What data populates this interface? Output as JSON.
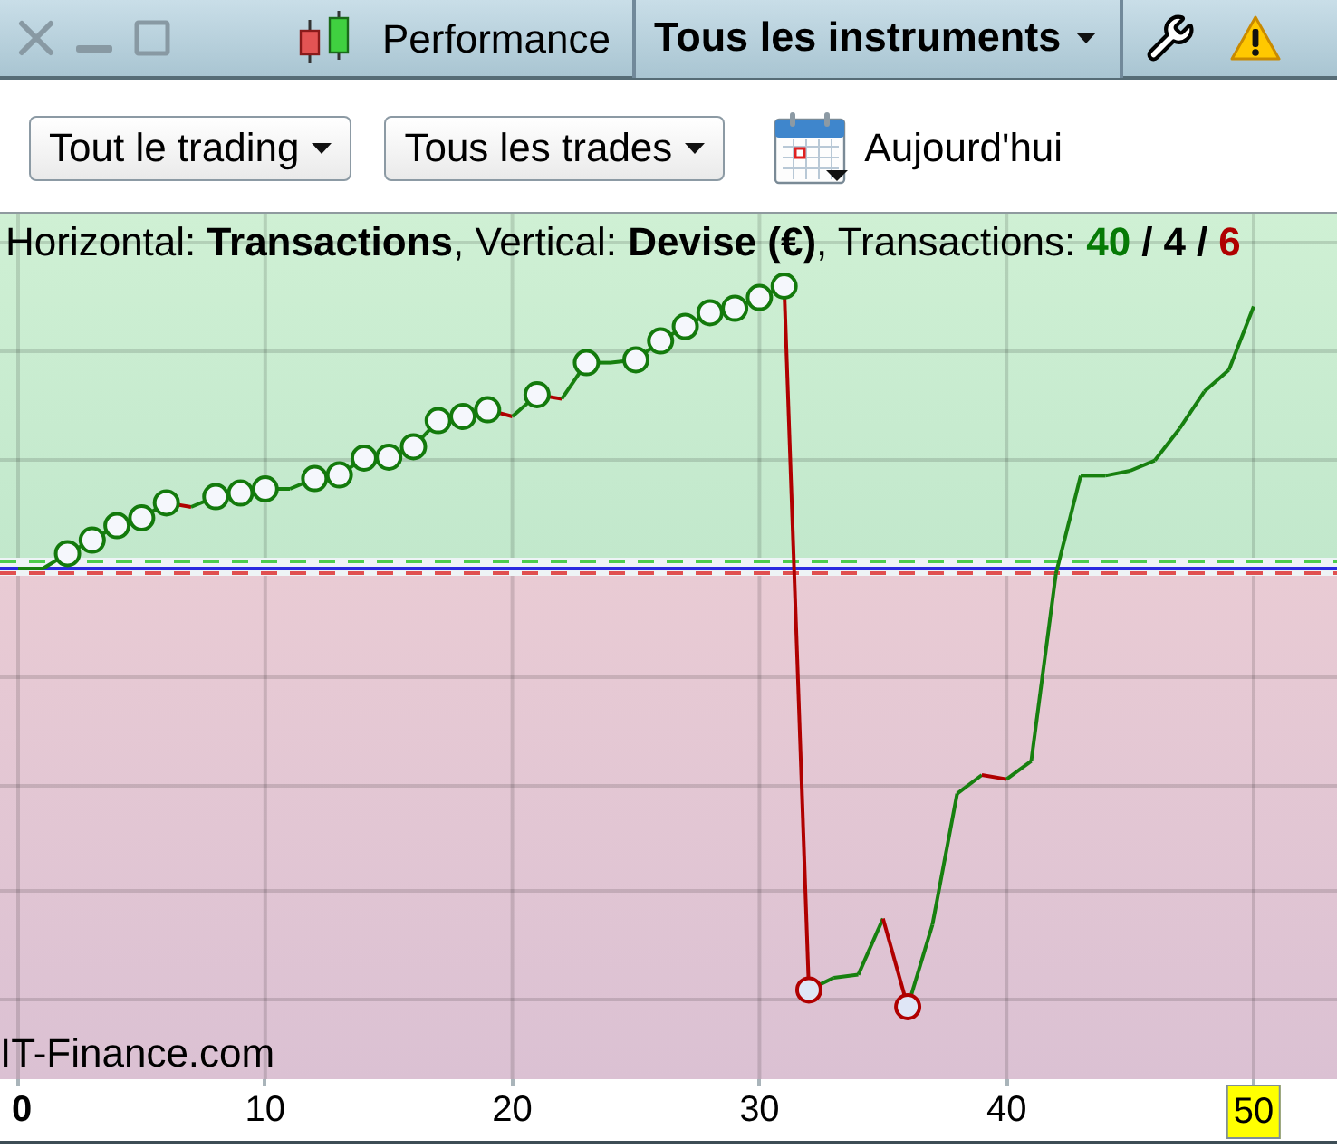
{
  "title_bar": {
    "title": "Performance",
    "instrument_filter": {
      "label": "Tous les instruments"
    }
  },
  "toolbar": {
    "dropdowns": [
      {
        "label": "Tout le trading"
      },
      {
        "label": "Tous les trades"
      }
    ],
    "date_button": {
      "label": "Aujourd'hui"
    }
  },
  "chart": {
    "caption": "Horizontal: **Transactions**, Vertical: **Devise (€)**, Transactions:",
    "counts": [
      {
        "text": "40",
        "color": "#067a06"
      },
      {
        "text": "4",
        "color": "#000000"
      },
      {
        "text": "6",
        "color": "#b00000"
      }
    ],
    "separators": [
      "/",
      "/"
    ],
    "brand_label": "IT-Finance.com"
  },
  "x_axis": {
    "labels": [
      {
        "text": "0",
        "kind": "origin"
      },
      {
        "text": "10",
        "kind": "tick"
      },
      {
        "text": "20",
        "kind": "tick"
      },
      {
        "text": "30",
        "kind": "tick"
      },
      {
        "text": "40",
        "kind": "tick"
      },
      {
        "text": "50",
        "kind": "current"
      }
    ]
  }
}
